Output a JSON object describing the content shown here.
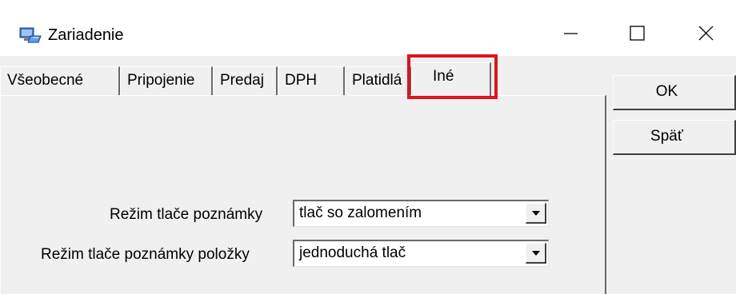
{
  "window": {
    "title": "Zariadenie",
    "icon": "computer-network-icon"
  },
  "tabs": [
    {
      "label": "Všeobecné"
    },
    {
      "label": "Pripojenie"
    },
    {
      "label": "Predaj"
    },
    {
      "label": "DPH"
    },
    {
      "label": "Platidlá"
    },
    {
      "label": "Iné",
      "active": true
    }
  ],
  "form": {
    "note_print_mode": {
      "label": "Režim tlače poznámky",
      "value": "tlač so zalomením"
    },
    "item_note_print_mode": {
      "label": "Režim tlače poznámky položky",
      "value": "jednoduchá tlač"
    }
  },
  "buttons": {
    "ok": "OK",
    "back": "Späť"
  },
  "colors": {
    "highlight": "#e2121e",
    "face": "#f0f0f0"
  }
}
